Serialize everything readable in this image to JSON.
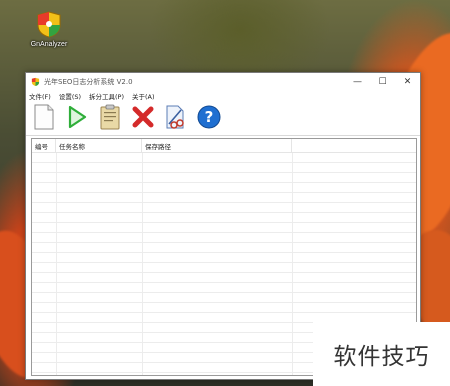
{
  "desktop": {
    "icon_label": "GnAnalyzer"
  },
  "window": {
    "title": "光年SEO日志分析系统 V2.0",
    "controls": {
      "minimize": "—",
      "maximize": "☐",
      "close": "✕"
    }
  },
  "menubar": {
    "items": [
      {
        "label": "文件(F)"
      },
      {
        "label": "设置(S)"
      },
      {
        "label": "拆分工具(P)"
      },
      {
        "label": "关于(A)"
      }
    ]
  },
  "toolbar": {
    "buttons": [
      {
        "icon": "new-file-icon"
      },
      {
        "icon": "play-icon"
      },
      {
        "icon": "clipboard-icon"
      },
      {
        "icon": "delete-icon"
      },
      {
        "icon": "split-tool-icon"
      },
      {
        "icon": "help-icon"
      }
    ]
  },
  "table": {
    "columns": [
      "编号",
      "任务名称",
      "保存路径"
    ],
    "rows": []
  },
  "watermark": {
    "text": "软件技巧"
  },
  "colors": {
    "play_green": "#2fae3a",
    "delete_red": "#d42a2a",
    "help_blue": "#1f6fd1"
  }
}
